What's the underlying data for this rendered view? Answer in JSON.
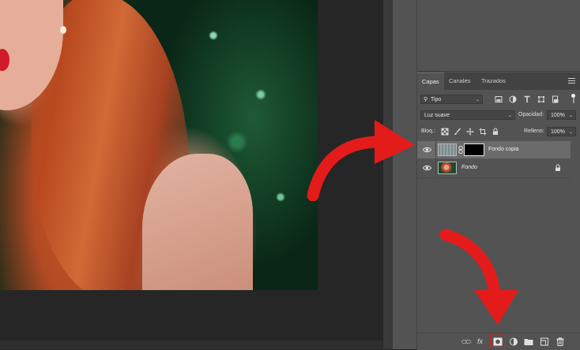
{
  "panel": {
    "tabs": [
      {
        "label": "Capas",
        "active": true
      },
      {
        "label": "Canales",
        "active": false
      },
      {
        "label": "Trazados",
        "active": false
      }
    ],
    "filter": {
      "value": "Tipo"
    },
    "blend_mode": {
      "value": "Luz suave"
    },
    "opacity": {
      "label": "Opacidad:",
      "value": "100%"
    },
    "lock": {
      "label": "Bloq.:"
    },
    "fill": {
      "label": "Relleno:",
      "value": "100%"
    },
    "layers": [
      {
        "name": "Fondo copia",
        "selected": true,
        "italic": false,
        "has_mask": true,
        "locked": false
      },
      {
        "name": "Fondo",
        "selected": false,
        "italic": true,
        "has_mask": false,
        "locked": true
      }
    ],
    "bottom_bar": {
      "fx_label": "fx"
    }
  },
  "colors": {
    "panel_bg": "#535353",
    "selected_layer": "#6b6b6b",
    "annotation_red": "#e41b1b"
  },
  "annotations": [
    "red-curved-arrow-to-layer-mask",
    "red-curved-arrow-to-add-mask-button"
  ]
}
